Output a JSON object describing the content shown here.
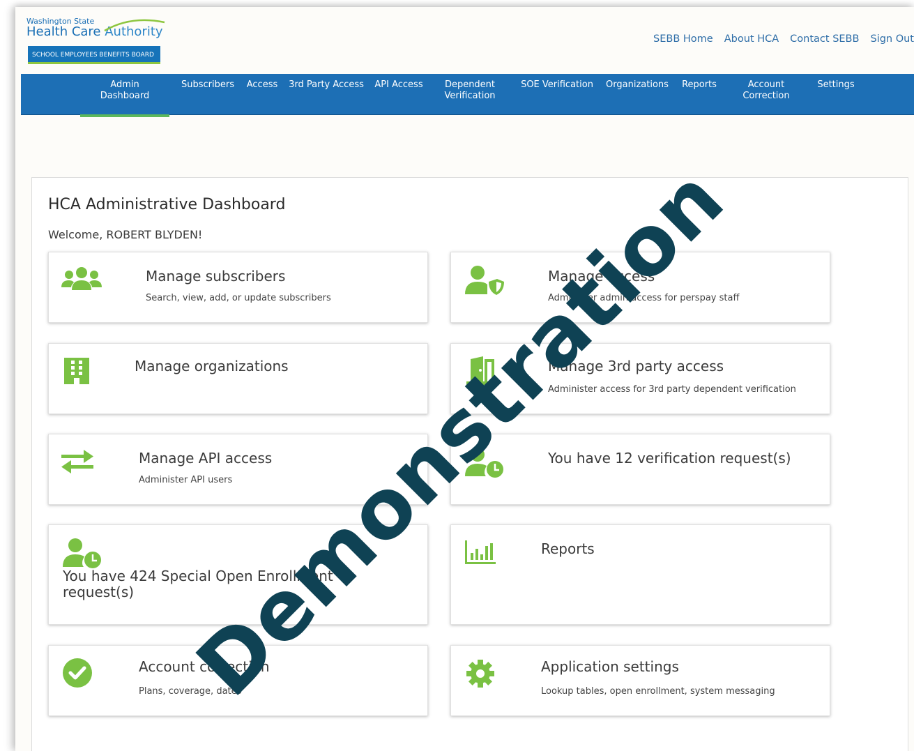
{
  "header": {
    "logo_small": "Washington State",
    "logo_main_1": "Health Care ",
    "logo_main_2": "Authority",
    "logo_band": "SCHOOL EMPLOYEES BENEFITS BOARD",
    "links": [
      "SEBB Home",
      "About HCA",
      "Contact SEBB",
      "Sign Out"
    ]
  },
  "nav": {
    "items": [
      {
        "line1": "Admin",
        "line2": "Dashboard",
        "active": true
      },
      {
        "line1": "Subscribers",
        "line2": ""
      },
      {
        "line1": "Access",
        "line2": ""
      },
      {
        "line1": "3rd Party Access",
        "line2": ""
      },
      {
        "line1": "API Access",
        "line2": ""
      },
      {
        "line1": "Dependent",
        "line2": "Verification"
      },
      {
        "line1": "SOE Verification",
        "line2": ""
      },
      {
        "line1": "Organizations",
        "line2": ""
      },
      {
        "line1": "Reports",
        "line2": ""
      },
      {
        "line1": "Account",
        "line2": "Correction"
      },
      {
        "line1": "Settings",
        "line2": ""
      }
    ]
  },
  "dashboard": {
    "title": "HCA Administrative Dashboard",
    "welcome": "Welcome, ROBERT BLYDEN!",
    "cards": {
      "subscribers": {
        "title": "Manage subscribers",
        "desc": "Search, view, add, or update subscribers",
        "icon": "users-icon"
      },
      "access": {
        "title": "Manage access",
        "desc": "Administer admin access for perspay staff",
        "icon": "user-shield-icon"
      },
      "organizations": {
        "title": "Manage organizations",
        "desc": "",
        "icon": "building-icon"
      },
      "third_party": {
        "title": "Manage 3rd party access",
        "desc": "Administer access for 3rd party dependent verification",
        "icon": "door-icon"
      },
      "api": {
        "title": "Manage API access",
        "desc": "Administer API users",
        "icon": "exchange-arrows-icon"
      },
      "verification": {
        "title": "You have 12 verification request(s)",
        "desc": "",
        "icon": "user-clock-icon"
      },
      "soe": {
        "title": "You have 424 Special Open Enrollment request(s)",
        "desc": "",
        "icon": "user-clock-icon"
      },
      "reports": {
        "title": "Reports",
        "desc": "",
        "icon": "bar-chart-icon"
      },
      "account_correction": {
        "title": "Account correction",
        "desc": "Plans, coverage, dates",
        "icon": "check-circle-icon"
      },
      "settings": {
        "title": "Application settings",
        "desc": "Lookup tables, open enrollment, system messaging",
        "icon": "gear-icon"
      }
    }
  },
  "watermark": "Demonstration",
  "colors": {
    "nav": "#1d6fb5",
    "accent_green": "#7ac143",
    "link": "#2f6ea8",
    "watermark": "#0f4254"
  }
}
